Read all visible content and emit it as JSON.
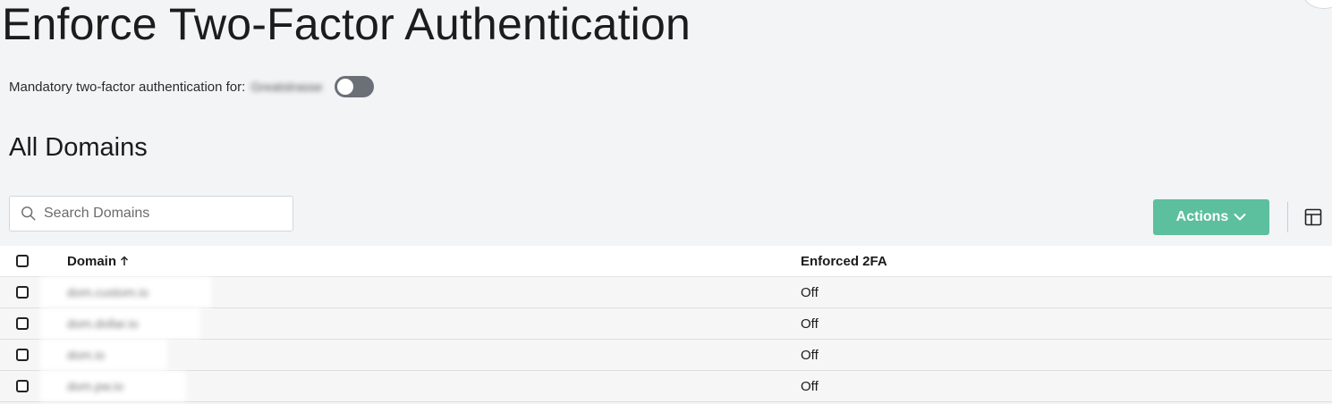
{
  "page": {
    "title": "Enforce Two-Factor Authentication"
  },
  "mandatory": {
    "label": "Mandatory two-factor authentication for:",
    "org_name": "Greatstrasse",
    "toggle_state": "off"
  },
  "section": {
    "heading": "All Domains"
  },
  "search": {
    "placeholder": "Search Domains",
    "value": ""
  },
  "toolbar": {
    "actions_label": "Actions"
  },
  "table": {
    "columns": [
      {
        "label": "Domain",
        "sort": "ascending"
      },
      {
        "label": "Enforced 2FA"
      }
    ],
    "rows": [
      {
        "domain": "dom.custom.io",
        "enforced": "Off"
      },
      {
        "domain": "dom.dollar.io",
        "enforced": "Off"
      },
      {
        "domain": "dom.io",
        "enforced": "Off"
      },
      {
        "domain": "dom.pw.io",
        "enforced": "Off"
      }
    ]
  },
  "colors": {
    "background": "#f3f4f6",
    "accent": "#5cbf9d",
    "toggle_off": "#6b6f76"
  },
  "icons": {
    "search": "search-icon",
    "actions_chevron": "chevron-down-icon",
    "sort": "arrow-up-icon",
    "columns": "table-columns-icon"
  }
}
